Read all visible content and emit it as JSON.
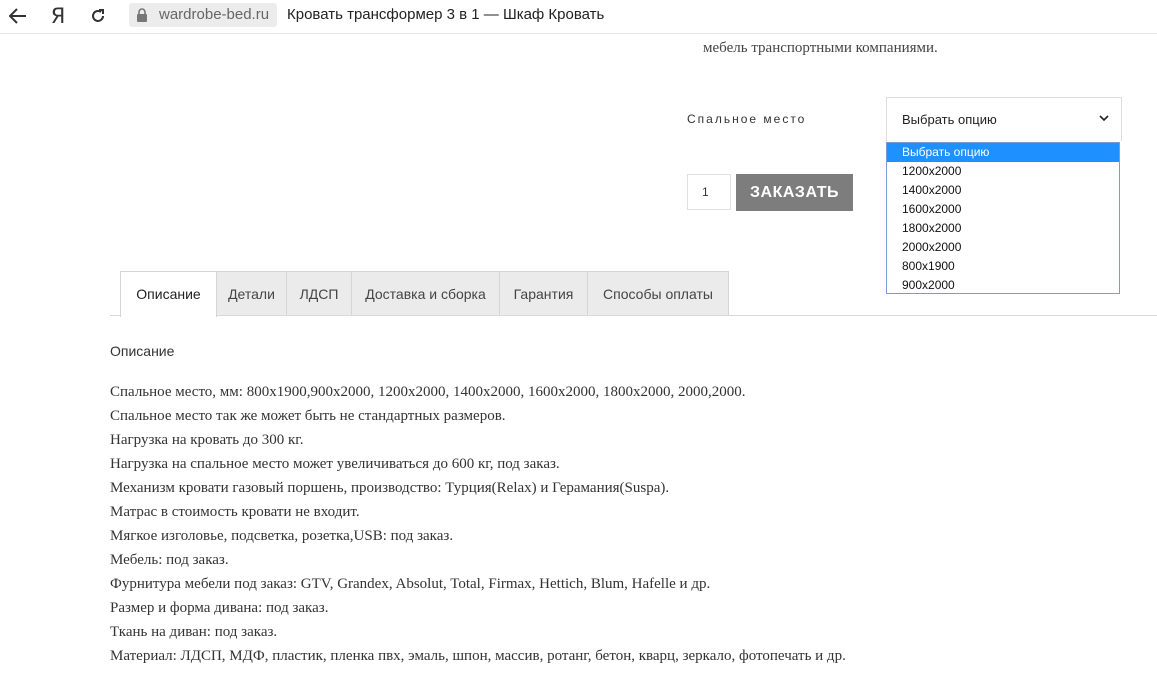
{
  "browser": {
    "domain": "wardrobe-bed.ru",
    "page_title": "Кровать трансформер 3 в 1 — Шкаф Кровать",
    "yandex_label": "Я"
  },
  "product": {
    "shipping_text": "мебель транспортными компаниями.",
    "variation_label": "Спальное место",
    "select": {
      "current_value": "Выбрать опцию",
      "options": [
        "Выбрать опцию",
        "1200x2000",
        "1400x2000",
        "1600x2000",
        "1800x2000",
        "2000x2000",
        "800x1900",
        "900x2000"
      ],
      "highlighted_index": 0
    },
    "quantity": "1",
    "order_button": "ЗАКАЗАТЬ"
  },
  "tabs": [
    {
      "label": "Описание",
      "active": true
    },
    {
      "label": "Детали",
      "active": false
    },
    {
      "label": "ЛДСП",
      "active": false
    },
    {
      "label": "Доставка и сборка",
      "active": false
    },
    {
      "label": "Гарантия",
      "active": false
    },
    {
      "label": "Способы оплаты",
      "active": false
    }
  ],
  "description": {
    "heading": "Описание",
    "lines": [
      "Спальное место, мм: 800x1900,900x2000, 1200x2000, 1400x2000, 1600x2000, 1800x2000, 2000,2000.",
      "Спальное место так же может быть не стандартных размеров.",
      "Нагрузка на кровать до 300 кг.",
      "Нагрузка на спальное место может увеличиваться до 600 кг, под заказ.",
      "Механизм кровати газовый поршень, производство: Турция(Relax) и Герамания(Suspa).",
      "Матрас в стоимость кровати не входит.",
      "Мягкое изголовье, подсветка, розетка,USB: под заказ.",
      "Мебель: под заказ.",
      "Фурнитура мебели под заказ: GTV, Grandex, Absolut, Total, Firmax, Hettich, Blum, Hafelle и др.",
      "Размер и форма дивана: под заказ.",
      "Ткань на диван: под заказ.",
      "Материал: ЛДСП, МДФ, пластик, пленка пвх, эмаль, шпон, массив, ротанг, бетон, кварц, зеркало, фотопечать и др."
    ]
  },
  "colors": {
    "order_button_bg": "#7d7d7d",
    "dropdown_highlight": "#1e90ff"
  }
}
